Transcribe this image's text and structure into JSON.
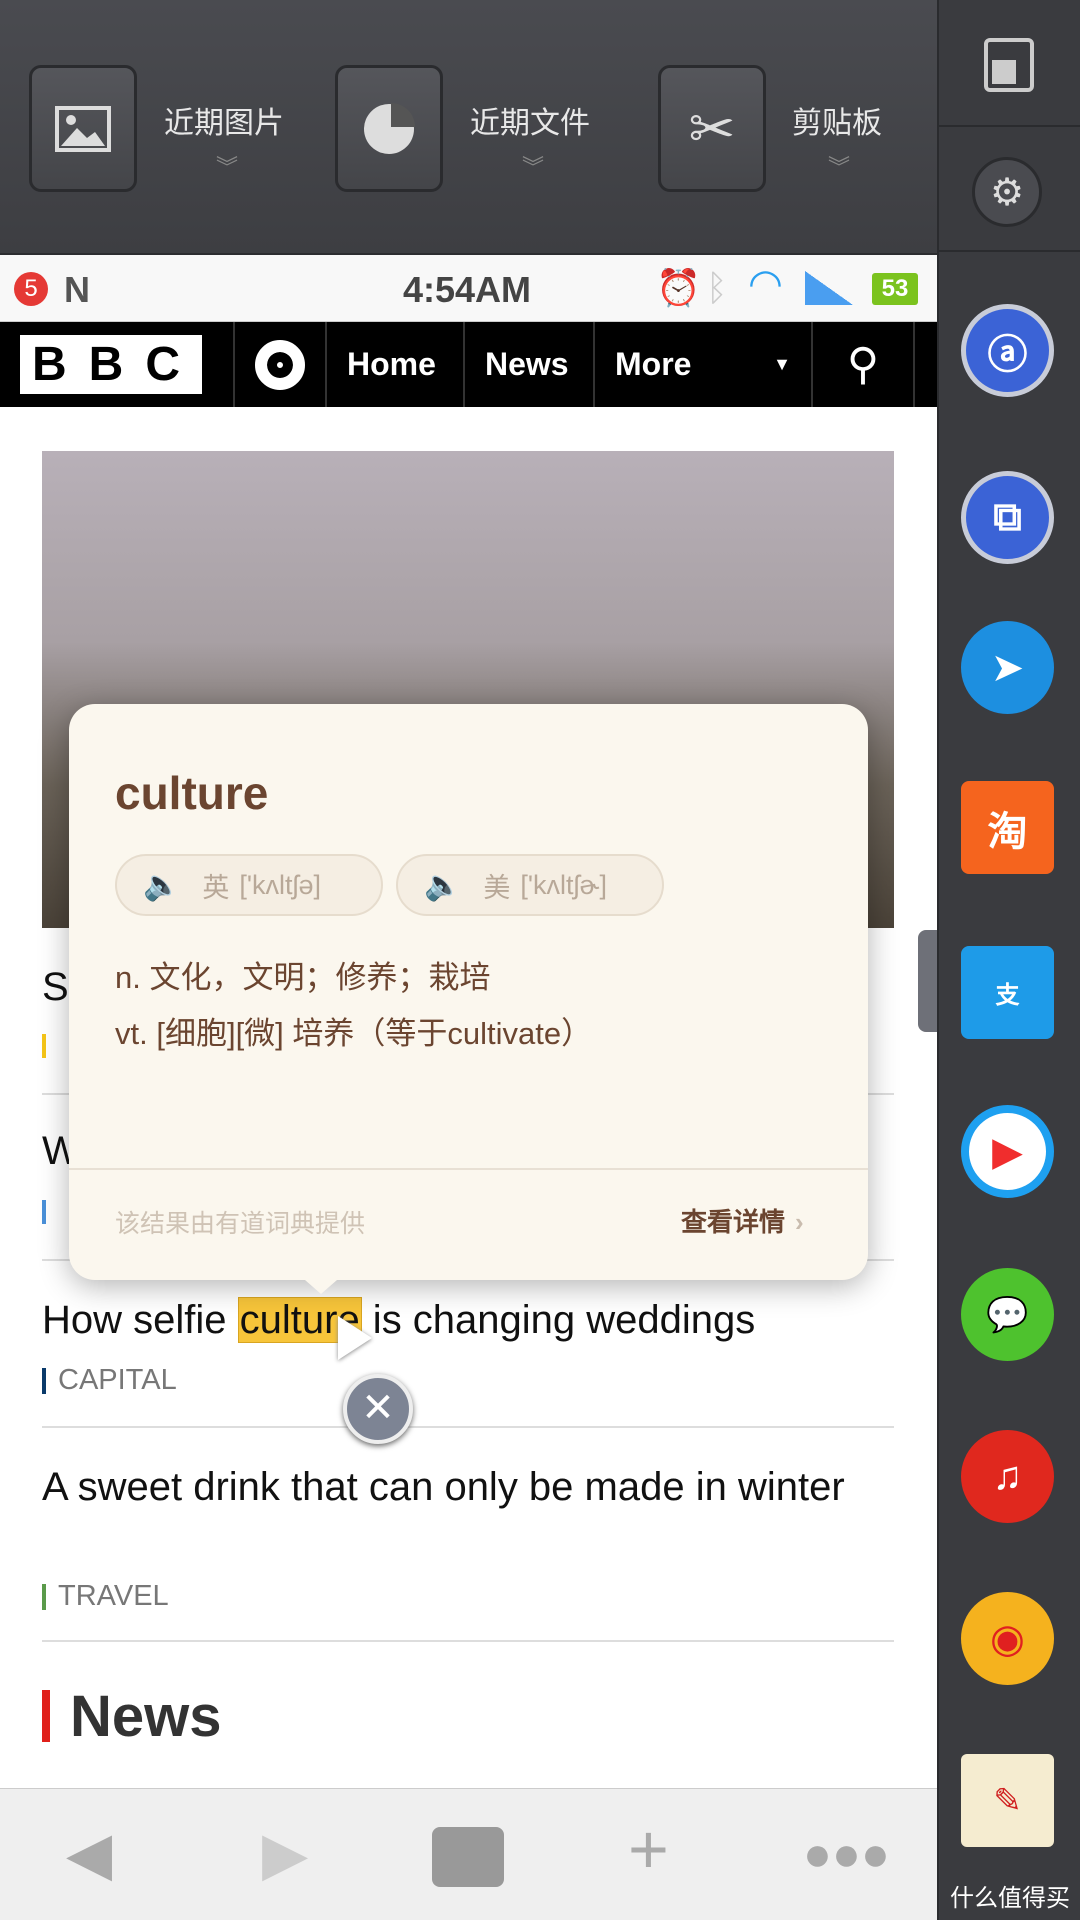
{
  "toolbar": {
    "items": [
      {
        "label": "近期图片",
        "icon": "image-icon"
      },
      {
        "label": "近期文件",
        "icon": "pie-chart-icon"
      },
      {
        "label": "剪贴板",
        "icon": "scissors-icon"
      }
    ]
  },
  "status_bar": {
    "notification_count": "5",
    "time": "4:54AM",
    "battery": "53"
  },
  "nav": {
    "logo": "BBC",
    "items": [
      "Home",
      "News",
      "More"
    ]
  },
  "articles": [
    {
      "title": "S",
      "tag_color": "#f5c518"
    },
    {
      "title": "W",
      "tag_color": "#4a90d9"
    },
    {
      "title_before": "How selfie ",
      "highlight": "culture",
      "title_after": " is changing weddings",
      "tag": "CAPITAL",
      "tag_color": "#0a3a6a"
    },
    {
      "title": "A sweet drink that can only be made in winter",
      "tag": "TRAVEL",
      "tag_color": "#5a9a4a"
    }
  ],
  "section": {
    "title": "News",
    "accent": "#e0201b"
  },
  "dictionary": {
    "word": "culture",
    "uk_label": "英",
    "uk_phonetic": "['kʌltʃə]",
    "us_label": "美",
    "us_phonetic": "['kʌltʃɚ]",
    "definitions": [
      "n. 文化，文明；修养；栽培",
      "vt. [细胞][微] 培养（等于cultivate）"
    ],
    "source": "该结果由有道词典提供",
    "details_link": "查看详情"
  },
  "sidebar": {
    "apps": [
      "youdao-dict-icon",
      "screen-rotate-icon",
      "dingtalk-icon",
      "taobao-icon",
      "alipay-wallet-icon",
      "video-player-icon",
      "wechat-icon",
      "netease-music-icon",
      "weibo-icon",
      "notes-icon"
    ],
    "taobao_text": "淘"
  },
  "watermark": "什么值得买"
}
